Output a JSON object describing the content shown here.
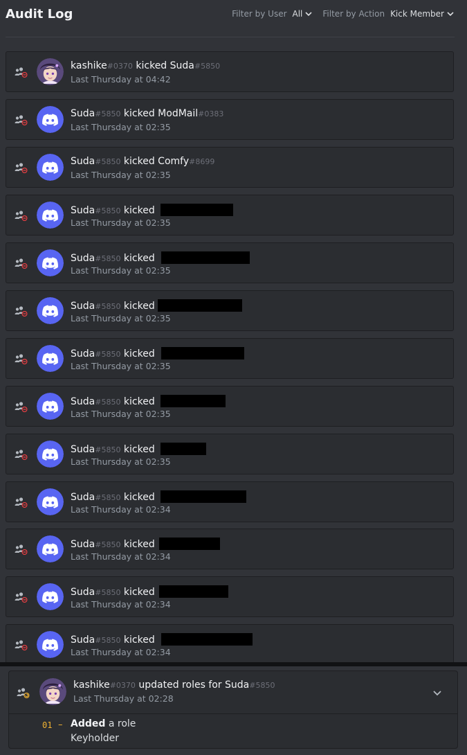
{
  "header": {
    "title": "Audit Log",
    "filter_user_label": "Filter by User",
    "filter_user_value": "All",
    "filter_action_label": "Filter by Action",
    "filter_action_value": "Kick Member"
  },
  "colors": {
    "blurple": "#5865f2",
    "kick_red": "#f23f43",
    "role_orange": "#f0b232"
  },
  "entries": [
    {
      "actor": "kashike",
      "actor_disc": "#0370",
      "action": "kicked",
      "target": "Suda",
      "target_disc": "#5850",
      "time": "Last Thursday at 04:42",
      "avatar": "custom-avatar"
    },
    {
      "actor": "Suda",
      "actor_disc": "#5850",
      "action": "kicked",
      "target": "ModMail",
      "target_disc": "#0383",
      "time": "Last Thursday at 02:35",
      "avatar": "discord-logo"
    },
    {
      "actor": "Suda",
      "actor_disc": "#5850",
      "action": "kicked",
      "target": "Comfy",
      "target_disc": "#8699",
      "time": "Last Thursday at 02:35",
      "avatar": "discord-logo"
    },
    {
      "actor": "Suda",
      "actor_disc": "#5850",
      "action": "kicked",
      "time": "Last Thursday at 02:35",
      "avatar": "discord-logo"
    },
    {
      "actor": "Suda",
      "actor_disc": "#5850",
      "action": "kicked",
      "time": "Last Thursday at 02:35",
      "avatar": "discord-logo"
    },
    {
      "actor": "Suda",
      "actor_disc": "#5850",
      "action": "kicked",
      "time": "Last Thursday at 02:35",
      "avatar": "discord-logo"
    },
    {
      "actor": "Suda",
      "actor_disc": "#5850",
      "action": "kicked",
      "time": "Last Thursday at 02:35",
      "avatar": "discord-logo"
    },
    {
      "actor": "Suda",
      "actor_disc": "#5850",
      "action": "kicked",
      "time": "Last Thursday at 02:35",
      "avatar": "discord-logo"
    },
    {
      "actor": "Suda",
      "actor_disc": "#5850",
      "action": "kicked",
      "time": "Last Thursday at 02:35",
      "avatar": "discord-logo"
    },
    {
      "actor": "Suda",
      "actor_disc": "#5850",
      "action": "kicked",
      "time": "Last Thursday at 02:34",
      "avatar": "discord-logo"
    },
    {
      "actor": "Suda",
      "actor_disc": "#5850",
      "action": "kicked",
      "time": "Last Thursday at 02:34",
      "avatar": "discord-logo"
    },
    {
      "actor": "Suda",
      "actor_disc": "#5850",
      "action": "kicked",
      "time": "Last Thursday at 02:34",
      "avatar": "discord-logo"
    },
    {
      "actor": "Suda",
      "actor_disc": "#5850",
      "action": "kicked",
      "time": "Last Thursday at 02:34",
      "avatar": "discord-logo"
    }
  ],
  "expanded_entry": {
    "actor": "kashike",
    "actor_disc": "#0370",
    "action": "updated roles for",
    "target": "Suda",
    "target_disc": "#5850",
    "time": "Last Thursday at 02:28",
    "change_number": "01",
    "change_dash": "–",
    "change_verb": "Added",
    "change_rest": "a role",
    "role_name": "Keyholder"
  }
}
